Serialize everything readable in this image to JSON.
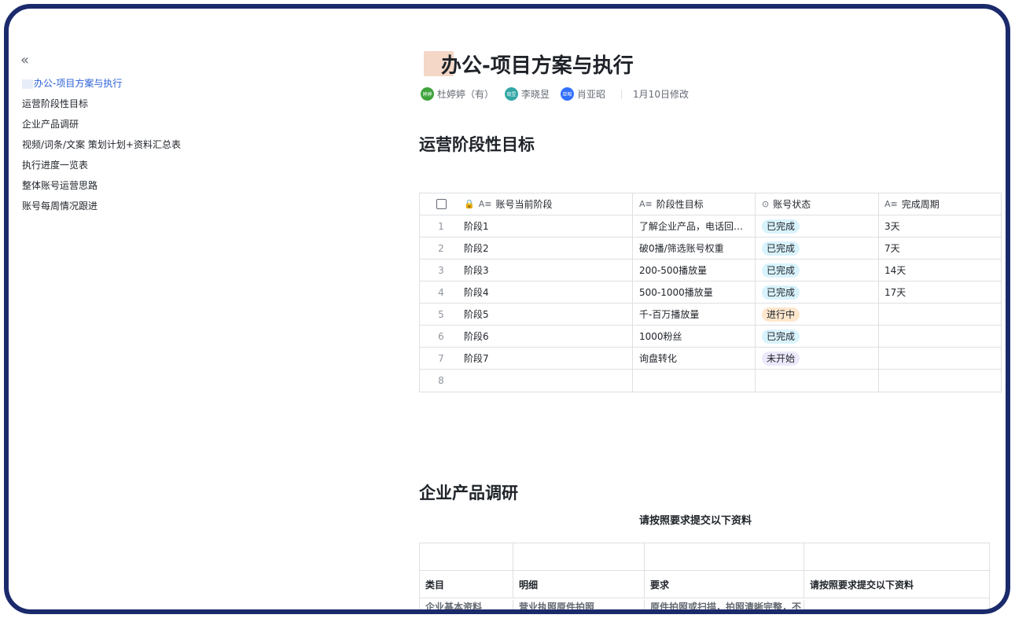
{
  "sidebar": {
    "collapse_icon": "«",
    "items": [
      {
        "label": "办公-项目方案与执行"
      },
      {
        "label": "运营阶段性目标"
      },
      {
        "label": "企业产品调研"
      },
      {
        "label": "视频/词条/文案 策划计划+资料汇总表"
      },
      {
        "label": "执行进度一览表"
      },
      {
        "label": "整体账号运营思路"
      },
      {
        "label": "账号每周情况跟进"
      }
    ]
  },
  "doc": {
    "title": "办公-项目方案与执行",
    "authors": [
      {
        "name": "杜婷婷（有）",
        "avatar_text": "婷婷",
        "color": "#3fa33b"
      },
      {
        "name": "李晓昱",
        "avatar_text": "晓昱",
        "color": "#32a6a6"
      },
      {
        "name": "肖亚昭",
        "avatar_text": "亚昭",
        "color": "#3370ff"
      }
    ],
    "modified": "1月10日修改"
  },
  "section1": {
    "heading": "运营阶段性目标",
    "table": {
      "columns": [
        "账号当前阶段",
        "阶段性目标",
        "账号状态",
        "完成周期"
      ],
      "column_icons": [
        "lock-icon",
        "text-field-icon",
        "status-field-icon",
        "text-field-icon"
      ],
      "rows": [
        {
          "n": "1",
          "stage": "阶段1",
          "goal": "了解企业产品，电话回…",
          "status": "已完成",
          "status_type": "done",
          "period": "3天"
        },
        {
          "n": "2",
          "stage": "阶段2",
          "goal": "破0播/筛选账号权重",
          "status": "已完成",
          "status_type": "done",
          "period": "7天"
        },
        {
          "n": "3",
          "stage": "阶段3",
          "goal": "200-500播放量",
          "status": "已完成",
          "status_type": "done",
          "period": "14天"
        },
        {
          "n": "4",
          "stage": "阶段4",
          "goal": "500-1000播放量",
          "status": "已完成",
          "status_type": "done",
          "period": "17天"
        },
        {
          "n": "5",
          "stage": "阶段5",
          "goal": "千-百万播放量",
          "status": "进行中",
          "status_type": "doing",
          "period": ""
        },
        {
          "n": "6",
          "stage": "阶段6",
          "goal": "1000粉丝",
          "status": "已完成",
          "status_type": "done",
          "period": ""
        },
        {
          "n": "7",
          "stage": "阶段7",
          "goal": "询盘转化",
          "status": "未开始",
          "status_type": "todo",
          "period": ""
        },
        {
          "n": "8",
          "stage": "",
          "goal": "",
          "status": "",
          "status_type": "",
          "period": ""
        }
      ]
    }
  },
  "section2": {
    "heading": "企业产品调研",
    "subheading": "请按照要求提交以下资料",
    "table": {
      "header": [
        "类目",
        "明细",
        "要求",
        "请按照要求提交以下资料"
      ],
      "partial_row": [
        "企业基本资料",
        "营业执照原件拍照",
        "原件拍照或扫描，拍照清晰完整，不",
        ""
      ]
    }
  }
}
